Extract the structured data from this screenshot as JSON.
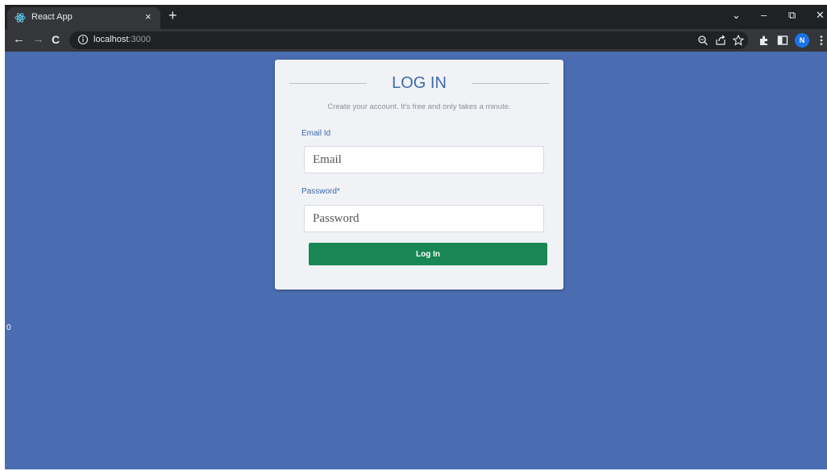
{
  "browser": {
    "tab_title": "React App",
    "tab_close_glyph": "×",
    "new_tab_glyph": "+",
    "window_controls": {
      "minimize": "–",
      "restore": "⧉",
      "close": "✕",
      "dropdown": "⌄"
    },
    "nav": {
      "back": "←",
      "forward": "→",
      "reload": "C"
    },
    "url_host": "localhost",
    "url_port": ":3000",
    "profile_initial": "N",
    "icons": [
      "zoom-icon",
      "share-icon",
      "bookmark-star-icon",
      "extensions-icon",
      "side-panel-icon",
      "menu-icon"
    ]
  },
  "page": {
    "stray_text": "0",
    "form": {
      "heading": "LOG IN",
      "subtitle": "Create your account. It's free and only takes a minute.",
      "email_label": "Email Id",
      "email_placeholder": "Email",
      "password_label": "Password*",
      "password_placeholder": "Password",
      "submit_label": "Log In"
    }
  },
  "colors": {
    "page_background": "#4a6db1",
    "card_background": "#f1f2f6",
    "accent_blue": "#3c6aac",
    "button_green": "#198754"
  }
}
